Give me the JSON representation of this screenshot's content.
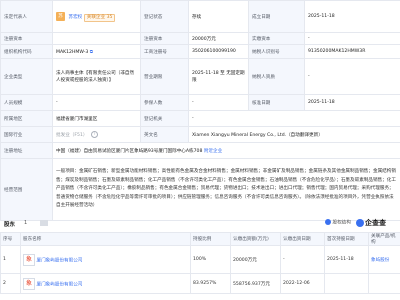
{
  "info": {
    "legal_rep_label": "法定代表人",
    "legal_rep_name": "苏宏权",
    "legal_rep_tag": "关联企业 35",
    "reg_status_label": "登记状态",
    "reg_status": "存续",
    "established_label": "成立日期",
    "established": "2025-11-18",
    "reg_capital_label": "注册资本",
    "reg_capital": "20000万元",
    "paidin_capital_label": "实缴资本",
    "paidin_capital": "-",
    "org_code_label": "组织机构代码",
    "org_code": "MAK12HMW-3",
    "biz_reg_no_label": "工商注册号",
    "biz_reg_no": "350206100099190",
    "taxpayer_no_label": "纳税人识别号",
    "taxpayer_no": "91350200MAK12HMW3R",
    "company_type_label": "企业类型",
    "company_type": "法人商事主体【有限责任公司（非自然人投资或控股的法人独资）】",
    "biz_term_label": "营业期限",
    "biz_term": "2025-11-18 至 无固定期限",
    "taxpayer_qual_label": "纳税人资质",
    "taxpayer_qual": "-",
    "staff_label": "人员规模",
    "staff": "-",
    "insured_label": "参保人数",
    "insured": "-",
    "approval_date_label": "核准日期",
    "approval_date": "2025-11-18",
    "region_label": "所属地区",
    "region": "福建省厦门市湖里区",
    "reg_authority_label": "登记机关",
    "reg_authority": "-",
    "intl_industry_label": "国际行业",
    "intl_industry": "批发业（F51）",
    "intl_industry_q": "?",
    "english_name_label": "英文名",
    "english_name": "Xiamen Xiangyu Mineral Energy Co., Ltd.（自动翻译更新）",
    "address_label": "注册地址",
    "address": "中国（福建）自由贸易试验区厦门片区象屿路93号厦门国际中心A栋708",
    "address_extra": "附近企业",
    "scope_label": "经营范围",
    "scope": "一般项目：金属矿石销售；新型金属功能材料销售；高性能有色金属及合金材料销售；金属材料销售；非金属矿及制品销售；金属链条及其他金属制品销售；金属结构销售；煤炭及制品销售；石墨及碳素制品销售；化工产品销售（不含许可类化工产品）；有色金属合金销售；石油制品销售（不含危险化学品）；石墨及碳素制品销售；化工产品销售（不含许可类化工产品）；橡胶制品销售；有色金属合金销售；贸易代理；货物进出口；技术进出口；进出口代理；销售代理；国内贸易代理；采购代理服务；普通货物仓储服务（不含危险化学品等需许可审批的项目）；供应链管理服务；信息咨询服务（不含许可类信息咨询服务）。（除依法须经批准的项目外，凭营业执照依法自主开展经营活动）"
  },
  "shareholders": {
    "title": "股东",
    "badge": "1",
    "right_label": "股权结构",
    "logo_label": "企查查",
    "columns": [
      "序号",
      "股东名称",
      "持股比例",
      "认缴出资额(万元)",
      "认缴出资日期",
      "首次持股日期",
      "关联产品/机构"
    ],
    "rows": [
      {
        "index": "1",
        "logo": "象",
        "name": "厦门象屿股份有限公司",
        "ratio": "100%",
        "amount": "20000万元",
        "subscribe_date": "-",
        "first_date": "2025-11-18",
        "related": "象屿股份"
      },
      {
        "index": "2",
        "logo": "象",
        "name": "厦门象屿股份有限公司",
        "ratio": "83.9257%",
        "amount": "558756.937万元",
        "subscribe_date": "2022-12-06",
        "first_date": "",
        "related": ""
      }
    ]
  },
  "colors": {
    "accent": "#3970f0",
    "label_bg": "#f4f7fd",
    "border": "#e5e8ef",
    "tag": "#d98a2c"
  }
}
